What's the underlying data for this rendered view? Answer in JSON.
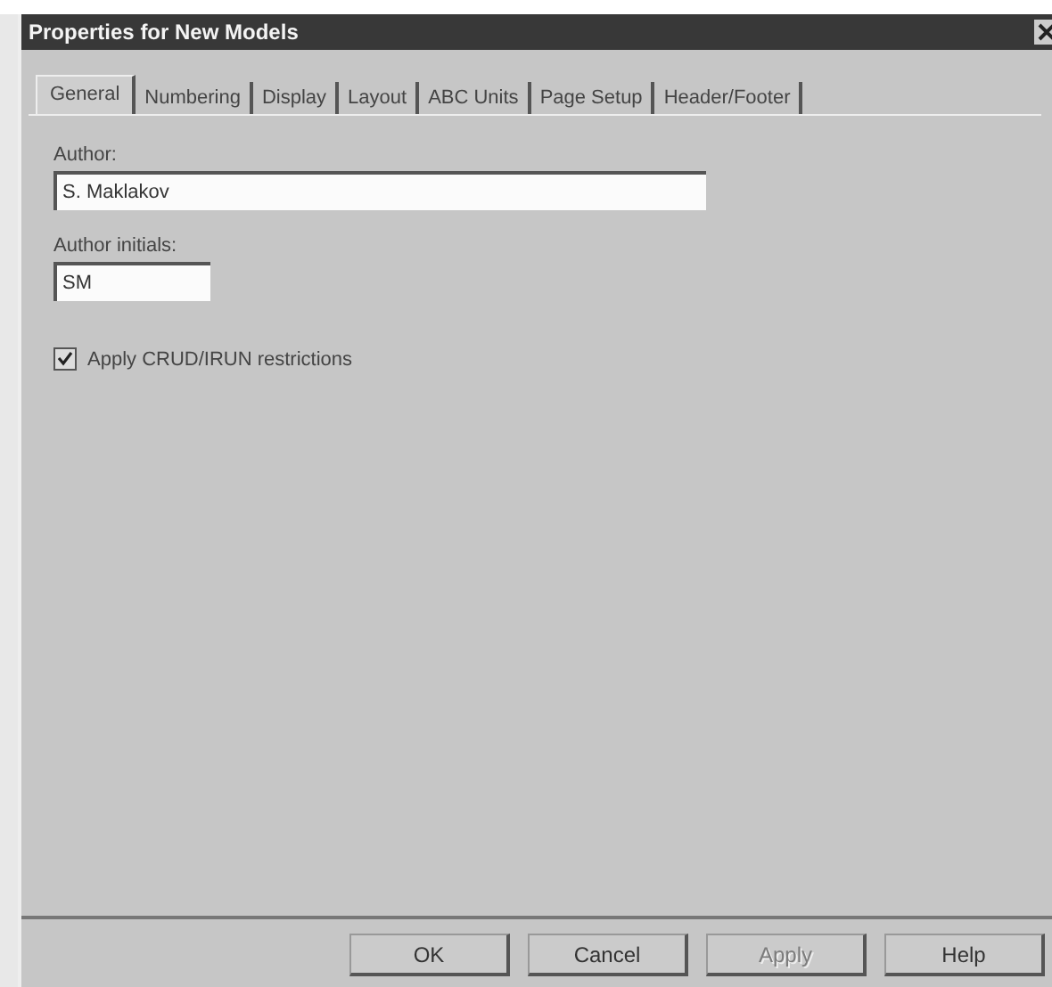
{
  "window": {
    "title": "Properties for New Models"
  },
  "tabs": [
    {
      "label": "General",
      "selected": true
    },
    {
      "label": "Numbering",
      "selected": false
    },
    {
      "label": "Display",
      "selected": false
    },
    {
      "label": "Layout",
      "selected": false
    },
    {
      "label": "ABC Units",
      "selected": false
    },
    {
      "label": "Page Setup",
      "selected": false
    },
    {
      "label": "Header/Footer",
      "selected": false
    }
  ],
  "author": {
    "label": "Author:",
    "value": "S. Maklakov"
  },
  "initials": {
    "label": "Author initials:",
    "value": "SM"
  },
  "crud": {
    "label": "Apply CRUD/IRUN restrictions",
    "checked": true
  },
  "buttons": [
    {
      "label": "OK",
      "disabled": false
    },
    {
      "label": "Cancel",
      "disabled": false
    },
    {
      "label": "Apply",
      "disabled": true
    },
    {
      "label": "Help",
      "disabled": false
    }
  ]
}
